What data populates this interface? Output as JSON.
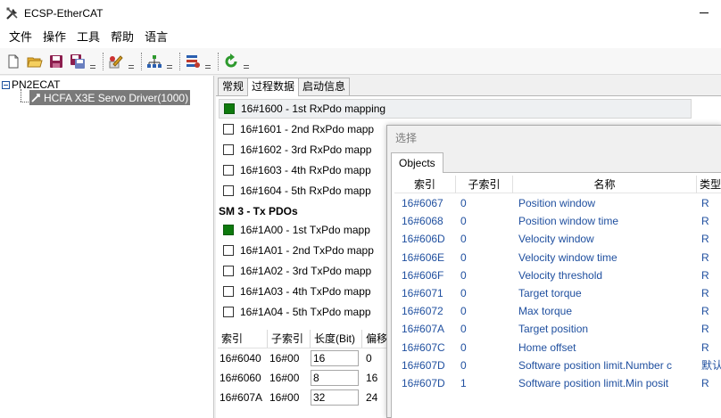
{
  "window": {
    "title": "ECSP-EtherCAT"
  },
  "menu": [
    "文件",
    "操作",
    "工具",
    "帮助",
    "语言"
  ],
  "toolbar": {
    "icons": [
      "new-file-icon",
      "open-folder-icon",
      "save-icon",
      "save-as-icon",
      "edit-icon",
      "network-icon",
      "device-config-icon",
      "refresh-icon"
    ],
    "accent_green": "#2e9a2e"
  },
  "tree": {
    "root": "PN2ECAT",
    "child": "HCFA X3E Servo Driver(1000)"
  },
  "tabs": [
    "常规",
    "过程数据",
    "启动信息"
  ],
  "pdo_rows": [
    {
      "text": "16#1600  -  1st RxPdo mapping",
      "checked": true
    },
    {
      "text": "16#1601  -  2nd RxPdo mapp",
      "checked": false
    },
    {
      "text": "16#1602  -  3rd RxPdo mapp",
      "checked": false
    },
    {
      "text": "16#1603  -  4th RxPdo mapp",
      "checked": false
    },
    {
      "text": "16#1604  -  5th RxPdo mapp",
      "checked": false
    }
  ],
  "sm3_header": "SM 3 - Tx PDOs",
  "tx_rows": [
    {
      "text": "16#1A00  -  1st TxPdo mapp",
      "checked": true
    },
    {
      "text": "16#1A01  -  2nd TxPdo mapp",
      "checked": false
    },
    {
      "text": "16#1A02  -  3rd TxPdo mapp",
      "checked": false
    },
    {
      "text": "16#1A03  -  4th TxPdo mapp",
      "checked": false
    },
    {
      "text": "16#1A04  -  5th TxPdo mapp",
      "checked": false
    }
  ],
  "grid": {
    "headers": [
      "索引",
      "子索引",
      "长度(Bit)",
      "偏移"
    ],
    "rows": [
      {
        "index": "16#6040",
        "sub": "16#00",
        "len": "16",
        "offset": "0"
      },
      {
        "index": "16#6060",
        "sub": "16#00",
        "len": "8",
        "offset": "16"
      },
      {
        "index": "16#607A",
        "sub": "16#00",
        "len": "32",
        "offset": "24"
      }
    ]
  },
  "dialog": {
    "title": "选择",
    "tab": "Objects",
    "headers": [
      "索引",
      "子索引",
      "名称",
      "类型"
    ],
    "rows": [
      {
        "index": "16#6067",
        "sub": "0",
        "name": "Position window",
        "type": "R"
      },
      {
        "index": "16#6068",
        "sub": "0",
        "name": "Position window time",
        "type": "R"
      },
      {
        "index": "16#606D",
        "sub": "0",
        "name": "Velocity window",
        "type": "R"
      },
      {
        "index": "16#606E",
        "sub": "0",
        "name": "Velocity window time",
        "type": "R"
      },
      {
        "index": "16#606F",
        "sub": "0",
        "name": "Velocity threshold",
        "type": "R"
      },
      {
        "index": "16#6071",
        "sub": "0",
        "name": "Target torque",
        "type": "R"
      },
      {
        "index": "16#6072",
        "sub": "0",
        "name": "Max torque",
        "type": "R"
      },
      {
        "index": "16#607A",
        "sub": "0",
        "name": "Target position",
        "type": "R"
      },
      {
        "index": "16#607C",
        "sub": "0",
        "name": "Home offset",
        "type": "R"
      },
      {
        "index": "16#607D",
        "sub": "0",
        "name": "Software position limit.Number c",
        "type": "默认"
      },
      {
        "index": "16#607D",
        "sub": "1",
        "name": "Software position limit.Min posit",
        "type": "R"
      }
    ]
  }
}
